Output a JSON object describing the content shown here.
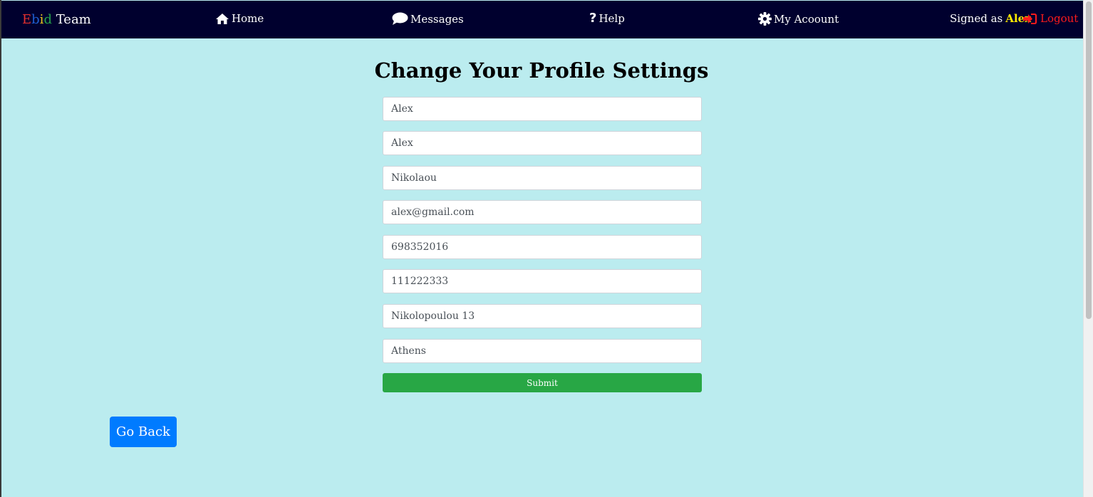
{
  "nav": {
    "brand": {
      "e": "E",
      "b": "b",
      "i": "i",
      "d": "d",
      "team": " Team"
    },
    "home": "Home",
    "messages": "Messages",
    "help": "Help",
    "account": "My Acoount",
    "signed_label": "Signed as",
    "username": "Alex",
    "logout": "Logout"
  },
  "icons": {
    "home": "home-icon",
    "messages": "comment-icon",
    "help": "question-icon",
    "account": "gear-icon",
    "logout": "sign-in-icon"
  },
  "colors": {
    "navbar_bg": "#00002e",
    "page_bg": "#bbecef",
    "submit_bg": "#28a745",
    "go_back_bg": "#007bff",
    "username": "#ffeb00",
    "logout": "#ff1b1b",
    "brand_e": "#e3302f",
    "brand_b": "#1f5fd1",
    "brand_i": "#f0c91a",
    "brand_d": "#26a24b"
  },
  "main": {
    "title": "Change Your Profile Settings",
    "fields": [
      {
        "value": "Alex"
      },
      {
        "value": "Alex"
      },
      {
        "value": "Nikolaou"
      },
      {
        "value": "alex@gmail.com"
      },
      {
        "value": "698352016"
      },
      {
        "value": "111222333"
      },
      {
        "value": "Nikolopoulou 13"
      },
      {
        "value": "Athens"
      }
    ],
    "submit_label": "Submit",
    "go_back_label": "Go Back"
  }
}
